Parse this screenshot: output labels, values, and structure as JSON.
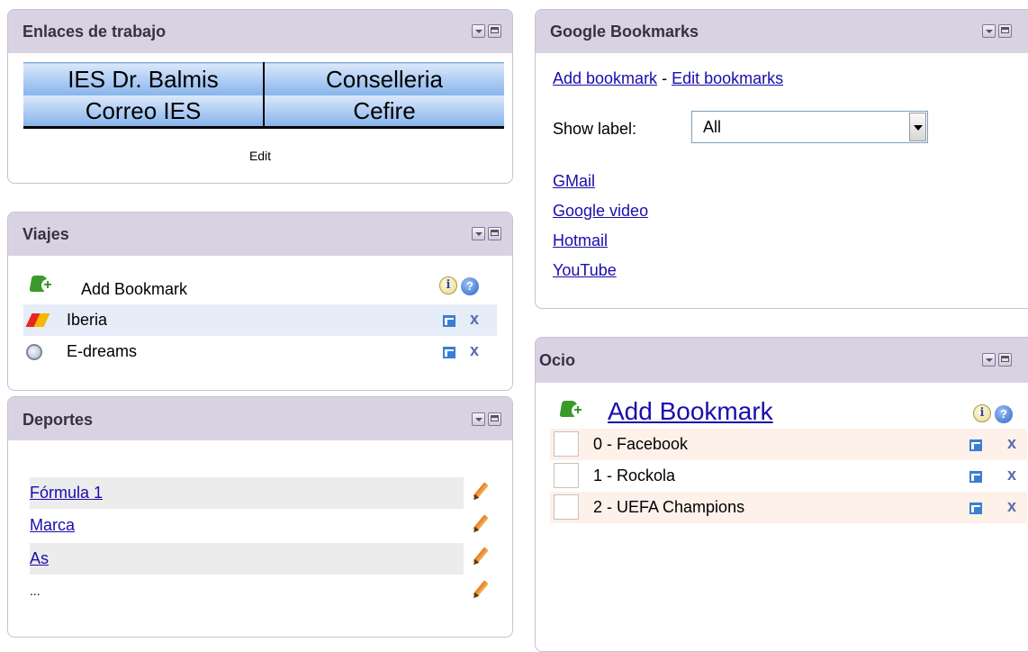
{
  "enlaces": {
    "title": "Enlaces de trabajo",
    "links": [
      "IES Dr. Balmis",
      "Conselleria",
      "Correo IES",
      "Cefire"
    ],
    "edit_label": "Edit"
  },
  "viajes": {
    "title": "Viajes",
    "add_label": "Add Bookmark",
    "items": [
      {
        "label": "Iberia",
        "icon": "iberia-logo-icon"
      },
      {
        "label": "E-dreams",
        "icon": "globe-icon"
      }
    ],
    "delete_glyph": "x"
  },
  "deportes": {
    "title": "Deportes",
    "items": [
      "Fórmula 1",
      "Marca",
      "As",
      "..."
    ]
  },
  "google": {
    "title": "Google Bookmarks",
    "add_link": "Add bookmark",
    "separator": " - ",
    "edit_link": "Edit bookmarks",
    "show_label": "Show label:",
    "select_value": "All",
    "bookmarks": [
      "GMail",
      "Google video",
      "Hotmail",
      "YouTube"
    ]
  },
  "ocio": {
    "title": "Ocio",
    "add_label": "Add Bookmark",
    "items": [
      "0 - Facebook",
      "1 - Rockola",
      "2 - UEFA Champions"
    ],
    "delete_glyph": "x"
  },
  "icons": {
    "info": "i",
    "help": "?"
  },
  "colors": {
    "header_bg": "#d9d2e3",
    "link": "#1a0dab",
    "row_highlight_viajes": "#e6ecf8",
    "row_highlight_deportes": "#ececec",
    "row_highlight_ocio": "#fdf1ea"
  }
}
